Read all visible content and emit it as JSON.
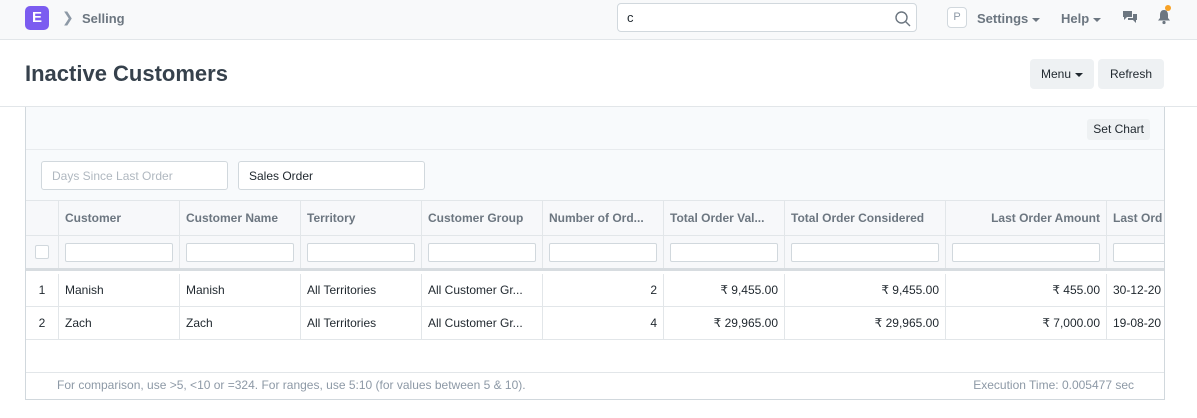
{
  "navbar": {
    "logo_letter": "E",
    "breadcrumb": "Selling",
    "search_value": "c",
    "avatar_letter": "P",
    "settings_label": "Settings",
    "help_label": "Help"
  },
  "page": {
    "title": "Inactive Customers",
    "menu_label": "Menu",
    "refresh_label": "Refresh"
  },
  "report": {
    "set_chart_label": "Set Chart",
    "filters": {
      "days_placeholder": "Days Since Last Order",
      "doctype_value": "Sales Order"
    },
    "columns": [
      "Customer",
      "Customer Name",
      "Territory",
      "Customer Group",
      "Number of Ord...",
      "Total Order Val...",
      "Total Order Considered",
      "Last Order Amount",
      "Last Ord"
    ],
    "rows": [
      {
        "idx": "1",
        "customer": "Manish",
        "customer_name": "Manish",
        "territory": "All Territories",
        "group": "All Customer Gr...",
        "num_orders": "2",
        "total_value": "₹ 9,455.00",
        "total_considered": "₹ 9,455.00",
        "last_amount": "₹ 455.00",
        "last_date": "30-12-20"
      },
      {
        "idx": "2",
        "customer": "Zach",
        "customer_name": "Zach",
        "territory": "All Territories",
        "group": "All Customer Gr...",
        "num_orders": "4",
        "total_value": "₹ 29,965.00",
        "total_considered": "₹ 29,965.00",
        "last_amount": "₹ 7,000.00",
        "last_date": "19-08-20"
      }
    ],
    "footer_hint": "For comparison, use >5, <10 or =324. For ranges, use 5:10 (for values between 5 & 10).",
    "execution_time": "Execution Time: 0.005477 sec"
  },
  "colors": {
    "brand": "#7b5cf0",
    "notification_dot": "#f8a225"
  }
}
